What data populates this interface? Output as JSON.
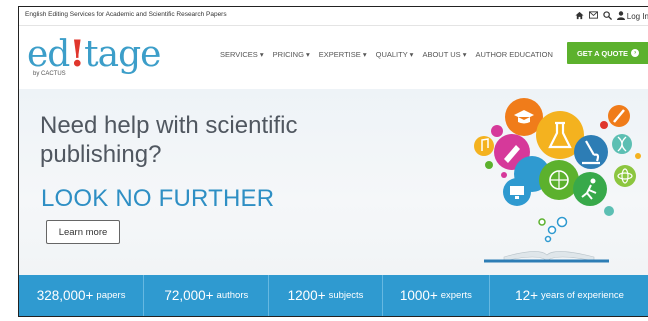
{
  "topbar": {
    "tagline": "English Editing Services for Academic and Scientific Research Papers",
    "icons": [
      "home-icon",
      "mail-icon",
      "search-icon",
      "user-icon"
    ],
    "login_label": "Log In"
  },
  "header": {
    "logo_text_a": "ed",
    "logo_text_bang": "!",
    "logo_text_b": "tage",
    "logo_sub": "by CACTUS",
    "nav": [
      {
        "label": "SERVICES"
      },
      {
        "label": "PRICING"
      },
      {
        "label": "EXPERTISE"
      },
      {
        "label": "QUALITY"
      },
      {
        "label": "ABOUT US"
      },
      {
        "label": "AUTHOR EDUCATION"
      }
    ],
    "quote_label": "GET A QUOTE"
  },
  "hero": {
    "title": "Need help with scientific publishing?",
    "subtitle": "LOOK NO FURTHER",
    "cta_label": "Learn more"
  },
  "stats": [
    {
      "num": "328,000+",
      "label": "papers"
    },
    {
      "num": "72,000+",
      "label": "authors"
    },
    {
      "num": "1200+",
      "label": "subjects"
    },
    {
      "num": "1000+",
      "label": "experts"
    },
    {
      "num": "12+",
      "label": "years of experience"
    }
  ],
  "colors": {
    "brand_blue": "#3c9ec9",
    "accent_red": "#e0362c",
    "quote_green": "#5cb12d",
    "stats_blue": "#2f9ad0",
    "headline_gray": "#505760"
  }
}
